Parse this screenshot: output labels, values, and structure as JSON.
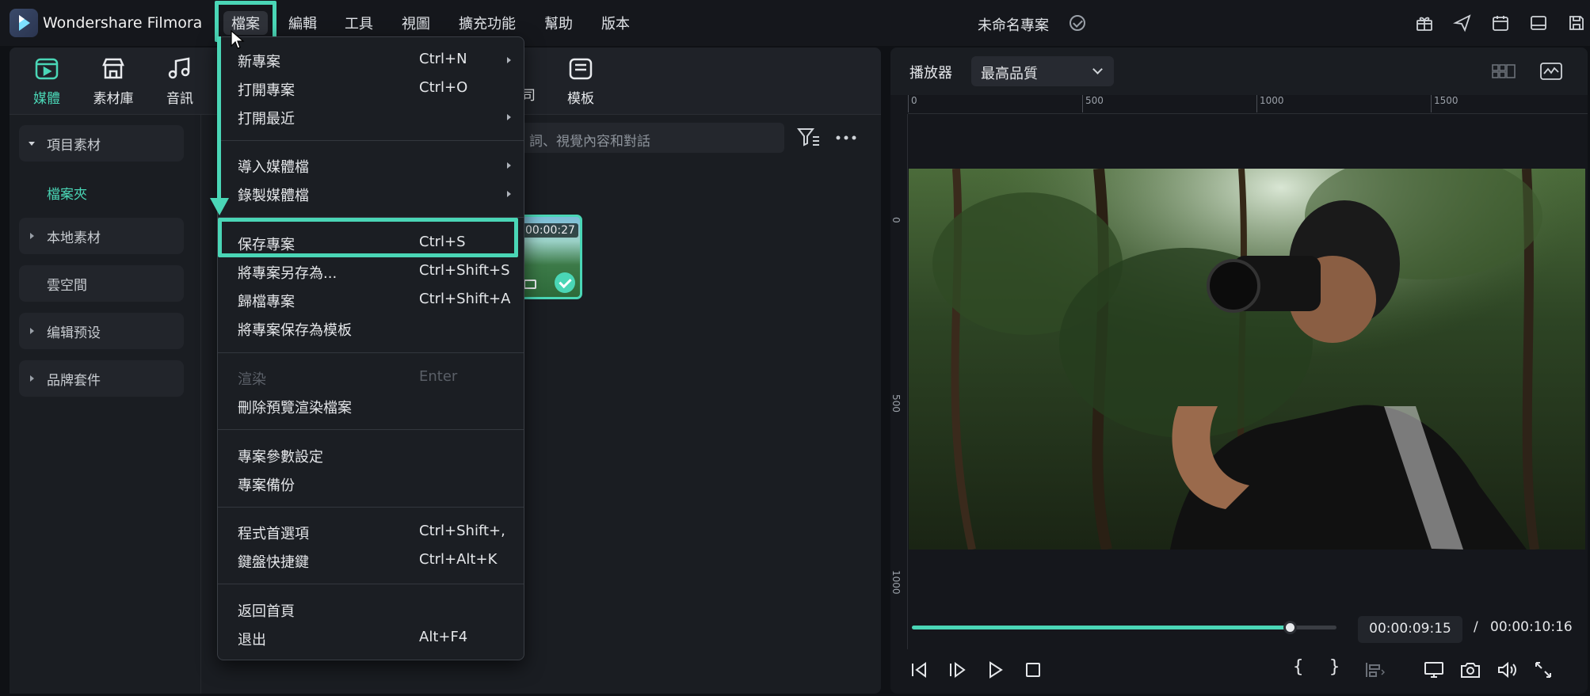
{
  "app": {
    "title": "Wondershare Filmora",
    "project_name": "未命名專案"
  },
  "menubar": {
    "items": [
      {
        "label": "檔案",
        "active": true
      },
      {
        "label": "編輯"
      },
      {
        "label": "工具"
      },
      {
        "label": "視圖"
      },
      {
        "label": "擴充功能"
      },
      {
        "label": "幫助"
      },
      {
        "label": "版本"
      }
    ]
  },
  "toolbar_tabs": [
    {
      "label": "媒體",
      "icon": "media-icon",
      "active": true
    },
    {
      "label": "素材庫",
      "icon": "store-icon"
    },
    {
      "label": "音訊",
      "icon": "music-icon"
    },
    {
      "label": "模板",
      "icon": "template-icon"
    }
  ],
  "partial_tab_label": "司",
  "sidebar": {
    "items": [
      {
        "label": "項目素材",
        "expanded": true
      },
      {
        "label": "本地素材"
      },
      {
        "label": "雲空間"
      },
      {
        "label": "编辑预设"
      },
      {
        "label": "品牌套件"
      }
    ],
    "sub_item": "檔案夾"
  },
  "search": {
    "placeholder_fragment": "詞、視覺內容和對話"
  },
  "media_thumb": {
    "duration": "00:00:27"
  },
  "file_menu": {
    "groups": [
      [
        {
          "label": "新專案",
          "shortcut": "Ctrl+N",
          "submenu": true
        },
        {
          "label": "打開專案",
          "shortcut": "Ctrl+O"
        },
        {
          "label": "打開最近",
          "shortcut": "",
          "submenu": true
        }
      ],
      [
        {
          "label": "導入媒體檔",
          "shortcut": "",
          "submenu": true
        },
        {
          "label": "錄製媒體檔",
          "shortcut": "",
          "submenu": true
        }
      ],
      [
        {
          "label": "保存專案",
          "shortcut": "Ctrl+S",
          "highlighted": true
        },
        {
          "label": "將專案另存為...",
          "shortcut": "Ctrl+Shift+S"
        },
        {
          "label": "歸檔專案",
          "shortcut": "Ctrl+Shift+A"
        },
        {
          "label": "將專案保存為模板",
          "shortcut": ""
        }
      ],
      [
        {
          "label": "渲染",
          "shortcut": "Enter",
          "disabled": true
        },
        {
          "label": "刪除預覽渲染檔案",
          "shortcut": ""
        }
      ],
      [
        {
          "label": "專案參數設定",
          "shortcut": ""
        },
        {
          "label": "專案備份",
          "shortcut": ""
        }
      ],
      [
        {
          "label": "程式首選項",
          "shortcut": "Ctrl+Shift+,"
        },
        {
          "label": "鍵盤快捷鍵",
          "shortcut": "Ctrl+Alt+K"
        }
      ],
      [
        {
          "label": "返回首頁",
          "shortcut": ""
        },
        {
          "label": "退出",
          "shortcut": "Alt+F4"
        }
      ]
    ]
  },
  "player": {
    "label": "播放器",
    "quality": "最高品質",
    "ruler_top": [
      "0",
      "500",
      "1000",
      "1500"
    ],
    "ruler_left": [
      "0",
      "500",
      "1000"
    ],
    "current_time": "00:00:09:15",
    "separator": "/",
    "total_time": "00:00:10:16",
    "progress_fraction": 0.89
  },
  "colors": {
    "accent": "#4ad6b6",
    "bg": "#0f1115"
  }
}
